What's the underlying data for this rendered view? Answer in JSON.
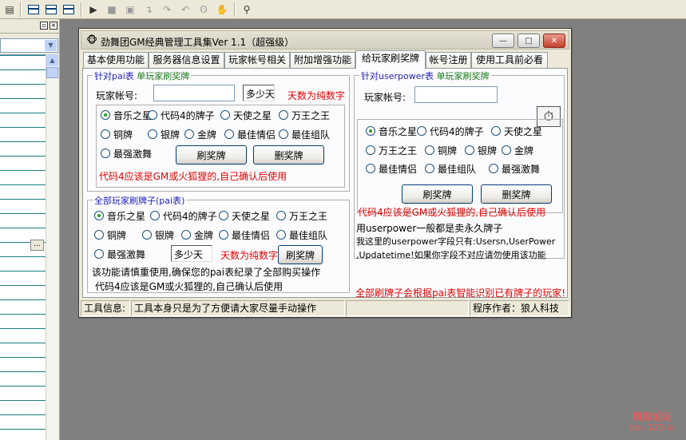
{
  "host": {
    "toolbar_icons": [
      "form-layout-icon",
      "grid-icon",
      "grid-icon",
      "grid-icon",
      "run-icon",
      "stop-icon",
      "pause-icon",
      "step-into-icon",
      "step-over-icon",
      "step-out-icon",
      "toggle-breakpoint-icon",
      "hand-icon",
      "watch-icon"
    ],
    "left_pane": {
      "pin": "▫",
      "close": "×",
      "dots": "..."
    }
  },
  "window": {
    "title": "劲舞团GM经典管理工具集Ver 1.1（超强级）",
    "caption": {
      "minimize": "—",
      "maximize": "□",
      "close": "✕"
    },
    "tabs": [
      "基本使用功能",
      "服务器信息设置",
      "玩家帐号相关",
      "附加增强功能",
      "给玩家刷奖牌",
      "帐号注册",
      "使用工具前必看"
    ],
    "active_tab": "给玩家刷奖牌"
  },
  "single_pai": {
    "group_title_a": "针对pai表",
    "group_title_b": "单玩家刷奖牌",
    "account_label": "玩家帐号:",
    "account_value": "",
    "days_value": "多少天",
    "days_hint": "天数为纯数字",
    "radios": [
      "音乐之星",
      "代码4的牌子",
      "天使之星",
      "万王之王",
      "铜牌",
      "银牌",
      "金牌",
      "最佳情侣",
      "最佳组队",
      "最强激舞"
    ],
    "selected": "音乐之星",
    "btn_add": "刷奖牌",
    "btn_delete": "删奖牌",
    "warning": "代码4应该是GM或火狐狸的,自己确认后使用"
  },
  "all_pai": {
    "group_title": "全部玩家刷牌子(pai表)",
    "radios": [
      "音乐之星",
      "代码4的牌子",
      "天使之星",
      "万王之王",
      "铜牌",
      "银牌",
      "金牌",
      "最佳情侣",
      "最佳组队",
      "最强激舞"
    ],
    "selected": "音乐之星",
    "days_value": "多少天",
    "days_hint": "天数为纯数字",
    "btn_add": "刷奖牌",
    "note1": "该功能请慎重使用,确保您的pai表纪录了全部购买操作",
    "note2": "代码4应该是GM或火狐狸的,自己确认后使用"
  },
  "userpower": {
    "group_title_a": "针对userpower表",
    "group_title_b": "单玩家刷奖牌",
    "account_label": "玩家帐号:",
    "account_value": "",
    "radios": [
      "音乐之星",
      "代码4的牌子",
      "天使之星",
      "万王之王",
      "铜牌",
      "银牌",
      "金牌",
      "最佳情侣",
      "最佳组队",
      "最强激舞"
    ],
    "selected": "音乐之星",
    "btn_add": "刷奖牌",
    "btn_delete": "删奖牌",
    "warning": "代码4应该是GM或火狐狸的,自己确认后使用",
    "info1": "用userpower一般都是卖永久牌子",
    "info2": "我这里的userpower字段只有:Usersn,UserPower",
    "info3": ",Updatetime!如果你字段不对应请勿使用该功能",
    "bottom_warning": "全部刷牌子会根据pai表智能识别已有牌子的玩家!"
  },
  "statusbar": {
    "label": "工具信息:",
    "message": "工具本身只是为了方便请大家尽量手动操作",
    "empty": "",
    "author": "程序作者：狼人科技"
  },
  "watermark": {
    "line1": "精易论坛",
    "line2": "bbs.125.la"
  },
  "colors": {
    "title_blue": "#1f1fb5",
    "title_green": "#1a7a1a",
    "warning_red": "#e00000",
    "desktop": "#808080"
  }
}
